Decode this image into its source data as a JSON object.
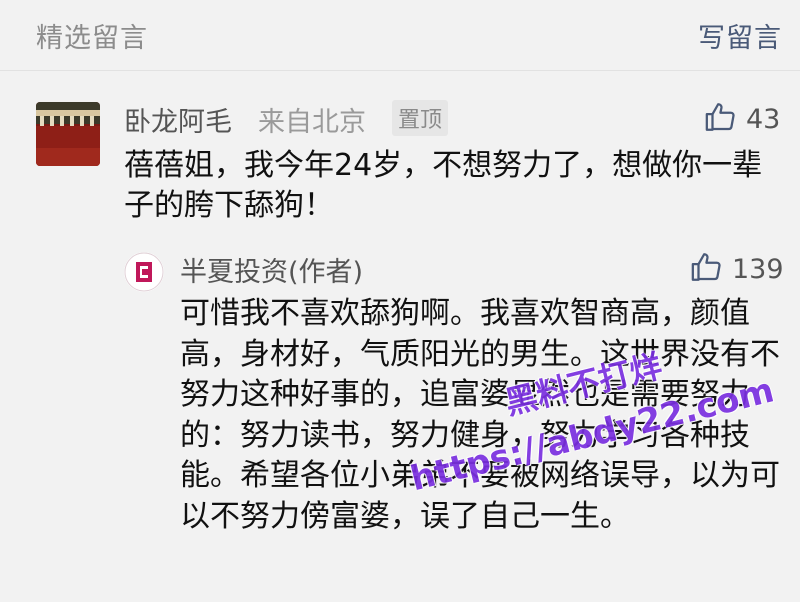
{
  "header": {
    "title": "精选留言",
    "write_label": "写留言"
  },
  "comment": {
    "author": "卧龙阿毛",
    "location": "来自北京",
    "pinned_label": "置顶",
    "likes": "43",
    "text": "蓓蓓姐，我今年24岁，不想努力了，想做你一辈子的胯下舔狗！"
  },
  "reply": {
    "author": "半夏投资(作者)",
    "likes": "139",
    "text": "可惜我不喜欢舔狗啊。我喜欢智商高，颜值高，身材好，气质阳光的男生。这世界没有不努力这种好事的，追富婆显然也是需要努力的：努力读书，努力健身，努力学习各种技能。希望各位小弟弟不要被网络误导，以为可以不努力傍富婆，误了自己一生。"
  },
  "watermark": {
    "line1": "黑料不打烊",
    "line2": "https://abdy22.com"
  },
  "colors": {
    "background": "#f2f2f2",
    "link": "#4a5a78",
    "watermark": "#7a2fe0"
  },
  "icons": [
    "thumbs-up-icon"
  ]
}
